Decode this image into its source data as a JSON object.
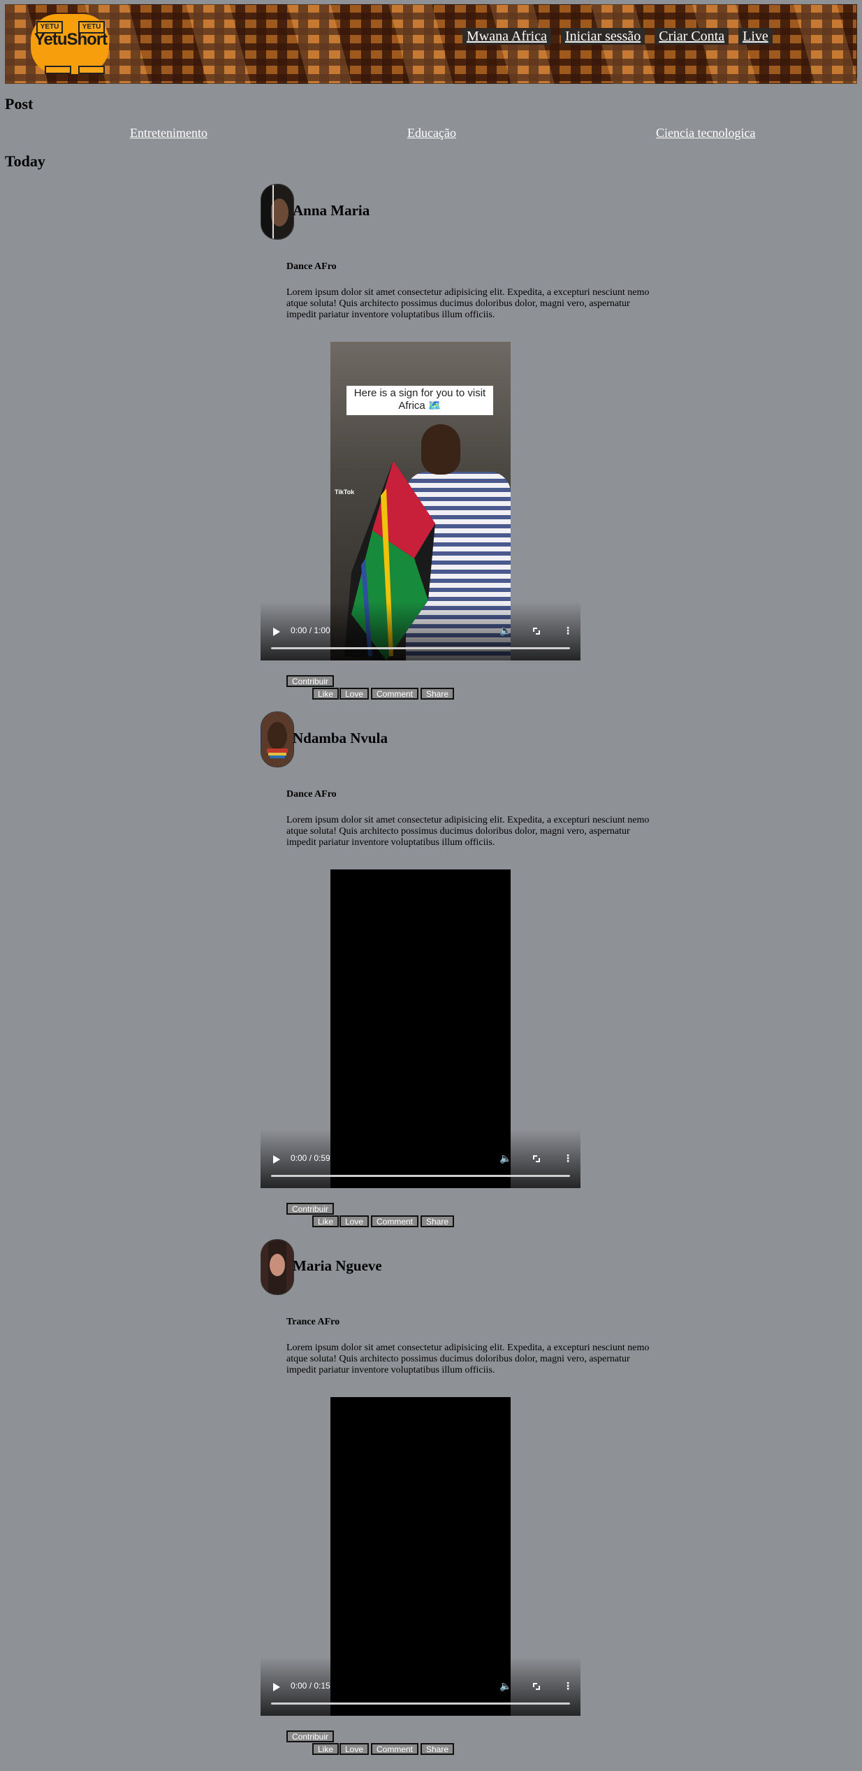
{
  "header": {
    "logo_badge_left": "YETU",
    "logo_badge_right": "YETU",
    "logo_text": "YetuShort",
    "nav": [
      "Mwana Africa",
      "Iniciar sessão",
      "Criar Conta",
      "Live"
    ]
  },
  "sections": {
    "post_heading": "Post",
    "today_heading": "Today"
  },
  "categories": [
    "Entretenimento",
    "Educação",
    "Ciencia tecnologica"
  ],
  "posts": [
    {
      "author": "Anna Maria",
      "title": "Dance AFro",
      "description": "Lorem ipsum dolor sit amet consectetur adipisicing elit. Expedita, a excepturi nesciunt nemo atque soluta! Quis architecto possimus ducimus doloribus dolor, magni vero, aspernatur impedit pariatur inventore voluptatibus illum officiis.",
      "video_time": "0:00 / 1:00",
      "video_overlay_text": "Here is a sign for you to visit Africa 🗺️",
      "watermark": "TikTok"
    },
    {
      "author": "Ndamba Nvula",
      "title": "Dance AFro",
      "description": "Lorem ipsum dolor sit amet consectetur adipisicing elit. Expedita, a excepturi nesciunt nemo atque soluta! Quis architecto possimus ducimus doloribus dolor, magni vero, aspernatur impedit pariatur inventore voluptatibus illum officiis.",
      "video_time": "0:00 / 0:59"
    },
    {
      "author": "Maria Ngueve",
      "title": "Trance AFro",
      "description": "Lorem ipsum dolor sit amet consectetur adipisicing elit. Expedita, a excepturi nesciunt nemo atque soluta! Quis architecto possimus ducimus doloribus dolor, magni vero, aspernatur impedit pariatur inventore voluptatibus illum officiis.",
      "video_time": "0:00 / 0:15"
    }
  ],
  "buttons": {
    "contribute": "Contribuir",
    "like": "Like",
    "love": "Love",
    "comment": "Comment",
    "share": "Share"
  }
}
